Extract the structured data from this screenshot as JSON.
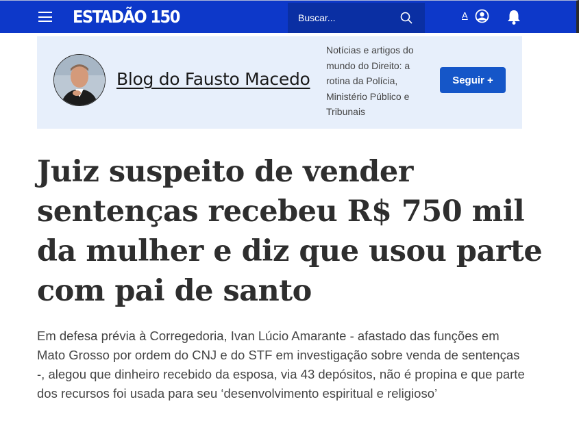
{
  "header": {
    "logo_text": "ESTADÃO 150",
    "search_placeholder": "Buscar...",
    "font_size_label": "A",
    "brand_color": "#0d38c9"
  },
  "blog": {
    "name": "Blog do Fausto Macedo",
    "description": "Notícias e artigos do mundo do Direito: a rotina da Polícia, Ministério Público e Tribunais",
    "follow_label": "Seguir +"
  },
  "article": {
    "headline": "Juiz suspeito de vender sentenças recebeu R$ 750 mil da mulher e diz que usou parte com pai de santo",
    "subtitle": "Em defesa prévia à Corregedoria, Ivan Lúcio Amarante - afastado das funções em Mato Grosso por ordem do CNJ e do STF em investigação sobre venda de sentenças -, alegou que dinheiro recebido da esposa, via 43 depósitos, não é propina e que parte dos recursos foi usada para seu ‘desenvolvimento espiritual e religioso’"
  },
  "icons": [
    "menu-icon",
    "search-icon",
    "user-icon",
    "bell-icon"
  ]
}
